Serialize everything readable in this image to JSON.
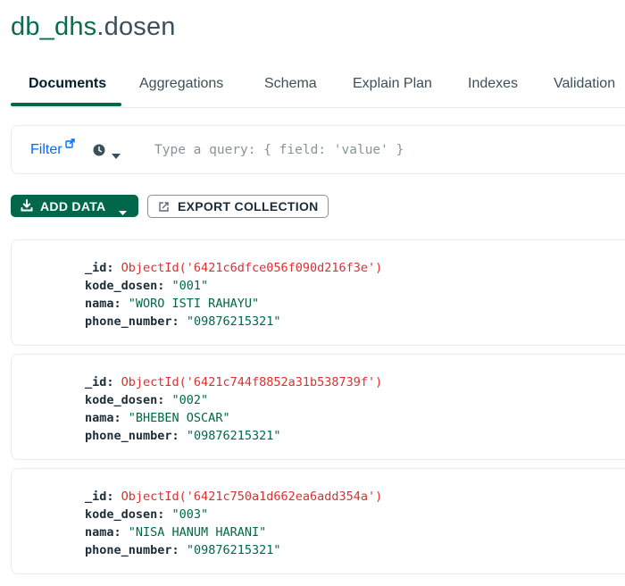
{
  "header": {
    "db": "db_dhs",
    "dot": ".",
    "collection": "dosen"
  },
  "tabs": [
    "Documents",
    "Aggregations",
    "Schema",
    "Explain Plan",
    "Indexes",
    "Validation"
  ],
  "query": {
    "filter_label": "Filter",
    "placeholder": "Type a query: { field: 'value' }",
    "value": ""
  },
  "toolbar": {
    "add_data_label": "ADD DATA",
    "export_label": "EXPORT COLLECTION"
  },
  "documents": [
    {
      "id_key": "_id:",
      "id_value": "ObjectId('6421c6dfce056f090d216f3e')",
      "kode_key": "kode_dosen:",
      "kode_value": "\"001\"",
      "nama_key": "nama:",
      "nama_value": "\"WORO ISTI RAHAYU\"",
      "phone_key": "phone_number:",
      "phone_value": "\"09876215321\""
    },
    {
      "id_key": "_id:",
      "id_value": "ObjectId('6421c744f8852a31b538739f')",
      "kode_key": "kode_dosen:",
      "kode_value": "\"002\"",
      "nama_key": "nama:",
      "nama_value": "\"BHEBEN OSCAR\"",
      "phone_key": "phone_number:",
      "phone_value": "\"09876215321\""
    },
    {
      "id_key": "_id:",
      "id_value": "ObjectId('6421c750a1d662ea6add354a')",
      "kode_key": "kode_dosen:",
      "kode_value": "\"003\"",
      "nama_key": "nama:",
      "nama_value": "\"NISA HANUM HARANI\"",
      "phone_key": "phone_number:",
      "phone_value": "\"09876215321\""
    }
  ],
  "colors": {
    "brand": "#00684a",
    "link": "#016bf8",
    "objectid": "#db3030",
    "string": "#00684a"
  },
  "icons": [
    "external-link-icon",
    "history-icon",
    "caret-down-icon",
    "download-icon",
    "export-icon"
  ]
}
